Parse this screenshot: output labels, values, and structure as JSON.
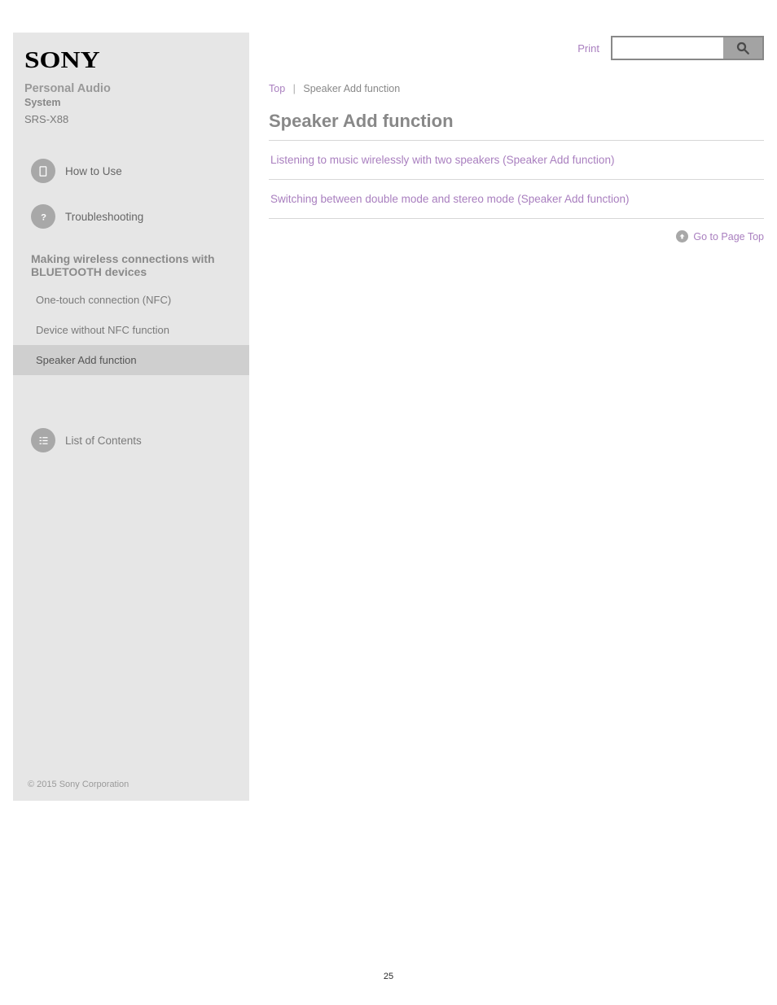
{
  "brand": "SONY",
  "product": {
    "line1": "Personal Audio",
    "line2": "System",
    "model": "SRS-X88"
  },
  "sidebar": {
    "nav": [
      {
        "label": "How to Use",
        "icon": "book-icon"
      },
      {
        "label": "Troubleshooting",
        "icon": "help-icon"
      }
    ],
    "section1_title": "Making wireless connections with BLUETOOTH devices",
    "section1_items": [
      "One-touch connection (NFC)",
      "Device without NFC function",
      "Speaker Add function"
    ],
    "contents_label": "List of Contents",
    "contents_icon": "list-icon"
  },
  "topbar": {
    "print_label": "Print",
    "search_value": ""
  },
  "breadcrumb": {
    "root": "Top",
    "current": "Speaker Add function"
  },
  "page": {
    "title": "Speaker Add function",
    "items": [
      "Listening to music wirelessly with two speakers (Speaker Add function)",
      "Switching between double mode and stereo mode (Speaker Add function)"
    ],
    "go_top": "Go to Page Top"
  },
  "copyright": "© 2015 Sony Corporation",
  "page_number": "25"
}
